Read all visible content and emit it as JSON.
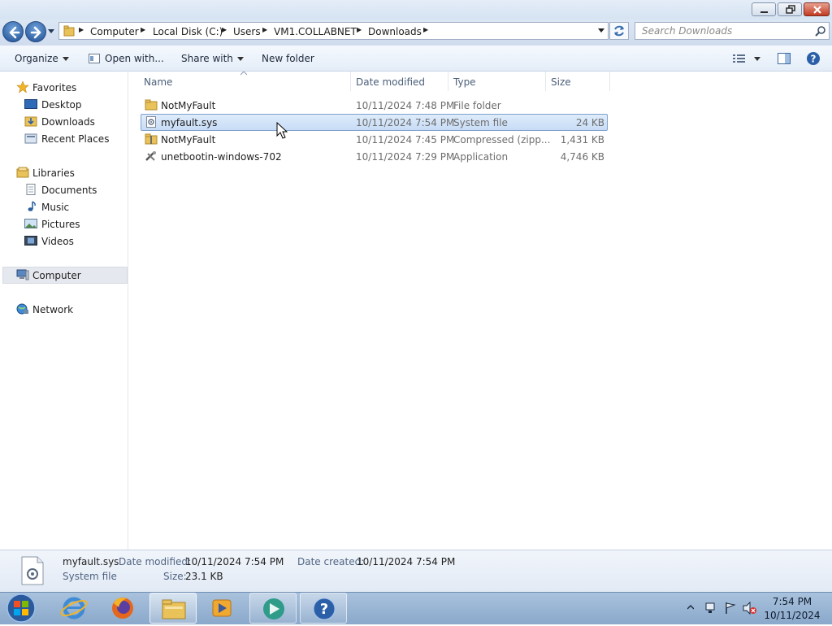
{
  "window": {
    "minimize_icon": "minimize-icon",
    "maximize_icon": "restore-icon",
    "close_icon": "close-icon"
  },
  "address": {
    "crumbs": [
      "Computer",
      "Local Disk (C:)",
      "Users",
      "VM1.COLLABNET",
      "Downloads"
    ],
    "search_placeholder": "Search Downloads"
  },
  "toolbar": {
    "organize": "Organize",
    "open_with": "Open with...",
    "share_with": "Share with",
    "new_folder": "New folder"
  },
  "nav": {
    "favorites": "Favorites",
    "desktop": "Desktop",
    "downloads": "Downloads",
    "recent_places": "Recent Places",
    "libraries": "Libraries",
    "documents": "Documents",
    "music": "Music",
    "pictures": "Pictures",
    "videos": "Videos",
    "computer": "Computer",
    "network": "Network"
  },
  "columns": {
    "name": "Name",
    "date_modified": "Date modified",
    "type": "Type",
    "size": "Size"
  },
  "files": [
    {
      "name": "NotMyFault",
      "date": "10/11/2024 7:48 PM",
      "type": "File folder",
      "size": "",
      "icon": "folder-icon"
    },
    {
      "name": "myfault.sys",
      "date": "10/11/2024 7:54 PM",
      "type": "System file",
      "size": "24 KB",
      "icon": "system-file-icon",
      "selected": true
    },
    {
      "name": "NotMyFault",
      "date": "10/11/2024 7:45 PM",
      "type": "Compressed (zipp...",
      "size": "1,431 KB",
      "icon": "zip-folder-icon"
    },
    {
      "name": "unetbootin-windows-702",
      "date": "10/11/2024 7:29 PM",
      "type": "Application",
      "size": "4,746 KB",
      "icon": "application-icon"
    }
  ],
  "details": {
    "filename": "myfault.sys",
    "filetype": "System file",
    "date_modified_label": "Date modified:",
    "date_modified": "10/11/2024 7:54 PM",
    "date_created_label": "Date created:",
    "date_created": "10/11/2024 7:54 PM",
    "size_label": "Size:",
    "size": "23.1 KB"
  },
  "taskbar": {
    "time": "7:54 PM",
    "date": "10/11/2024"
  }
}
